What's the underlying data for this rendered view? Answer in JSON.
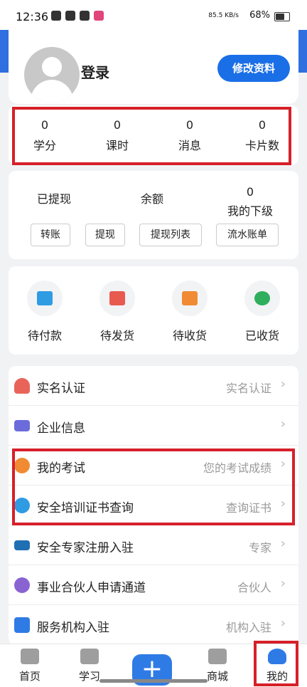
{
  "status_bar": {
    "time": "12:36",
    "network_speed": "85.5 KB/s",
    "battery": "68%"
  },
  "header": {
    "login_label": "登录",
    "edit_profile_label": "修改资料"
  },
  "stats": [
    {
      "value": "0",
      "label": "学分"
    },
    {
      "value": "0",
      "label": "课时"
    },
    {
      "value": "0",
      "label": "消息"
    },
    {
      "value": "0",
      "label": "卡片数"
    }
  ],
  "wallet": {
    "withdrawn_label": "已提现",
    "balance_label": "余额",
    "subordinates_value": "0",
    "subordinates_label": "我的下级",
    "buttons": [
      "转账",
      "提现",
      "提现列表",
      "流水账单"
    ]
  },
  "orders": [
    {
      "label": "待付款",
      "icon": "wallet-icon",
      "color": "#2f9be3"
    },
    {
      "label": "待发货",
      "icon": "truck-icon",
      "color": "#e85a4f"
    },
    {
      "label": "待收货",
      "icon": "package-icon",
      "color": "#f08b33"
    },
    {
      "label": "已收货",
      "icon": "star-badge-icon",
      "color": "#2fae5e"
    }
  ],
  "menu": [
    {
      "title": "实名认证",
      "subtitle": "实名认证",
      "icon": "person-icon",
      "color": "#e8645a"
    },
    {
      "title": "企业信息",
      "subtitle": "",
      "icon": "id-card-icon",
      "color": "#6b6bdc"
    },
    {
      "title": "我的考试",
      "subtitle": "您的考试成绩",
      "icon": "chat-bubble-icon",
      "color": "#f08b33"
    },
    {
      "title": "安全培训证书查询",
      "subtitle": "查询证书",
      "icon": "search-icon",
      "color": "#2f9be3"
    },
    {
      "title": "安全专家注册入驻",
      "subtitle": "专家",
      "icon": "graduation-cap-icon",
      "color": "#1f6fb3"
    },
    {
      "title": "事业合伙人申请通道",
      "subtitle": "合伙人",
      "icon": "handshake-icon",
      "color": "#8a63d2"
    },
    {
      "title": "服务机构入驻",
      "subtitle": "机构入驻",
      "icon": "building-icon",
      "color": "#2f7be6"
    }
  ],
  "tabs": [
    {
      "label": "首页",
      "icon": "home-icon"
    },
    {
      "label": "学习",
      "icon": "folder-icon"
    },
    {
      "label": "商城",
      "icon": "shop-icon"
    },
    {
      "label": "我的",
      "icon": "user-icon",
      "active": true
    }
  ],
  "accent_color": "#1a6fe6",
  "highlight_color": "#d6202a"
}
